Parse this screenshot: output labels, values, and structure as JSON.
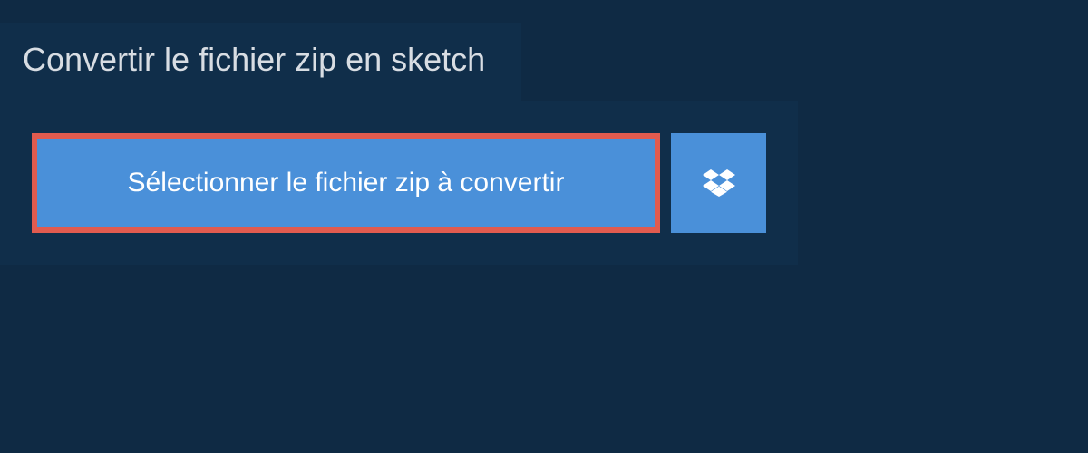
{
  "title": "Convertir le fichier zip en sketch",
  "select_button_label": "Sélectionner le fichier zip à convertir",
  "dropbox_icon_name": "dropbox-icon",
  "colors": {
    "background": "#0f2a44",
    "panel": "#102e4a",
    "button_bg": "#4a90d9",
    "button_border": "#e15b4f",
    "title_text": "#d8dde3",
    "button_text": "#ffffff"
  }
}
